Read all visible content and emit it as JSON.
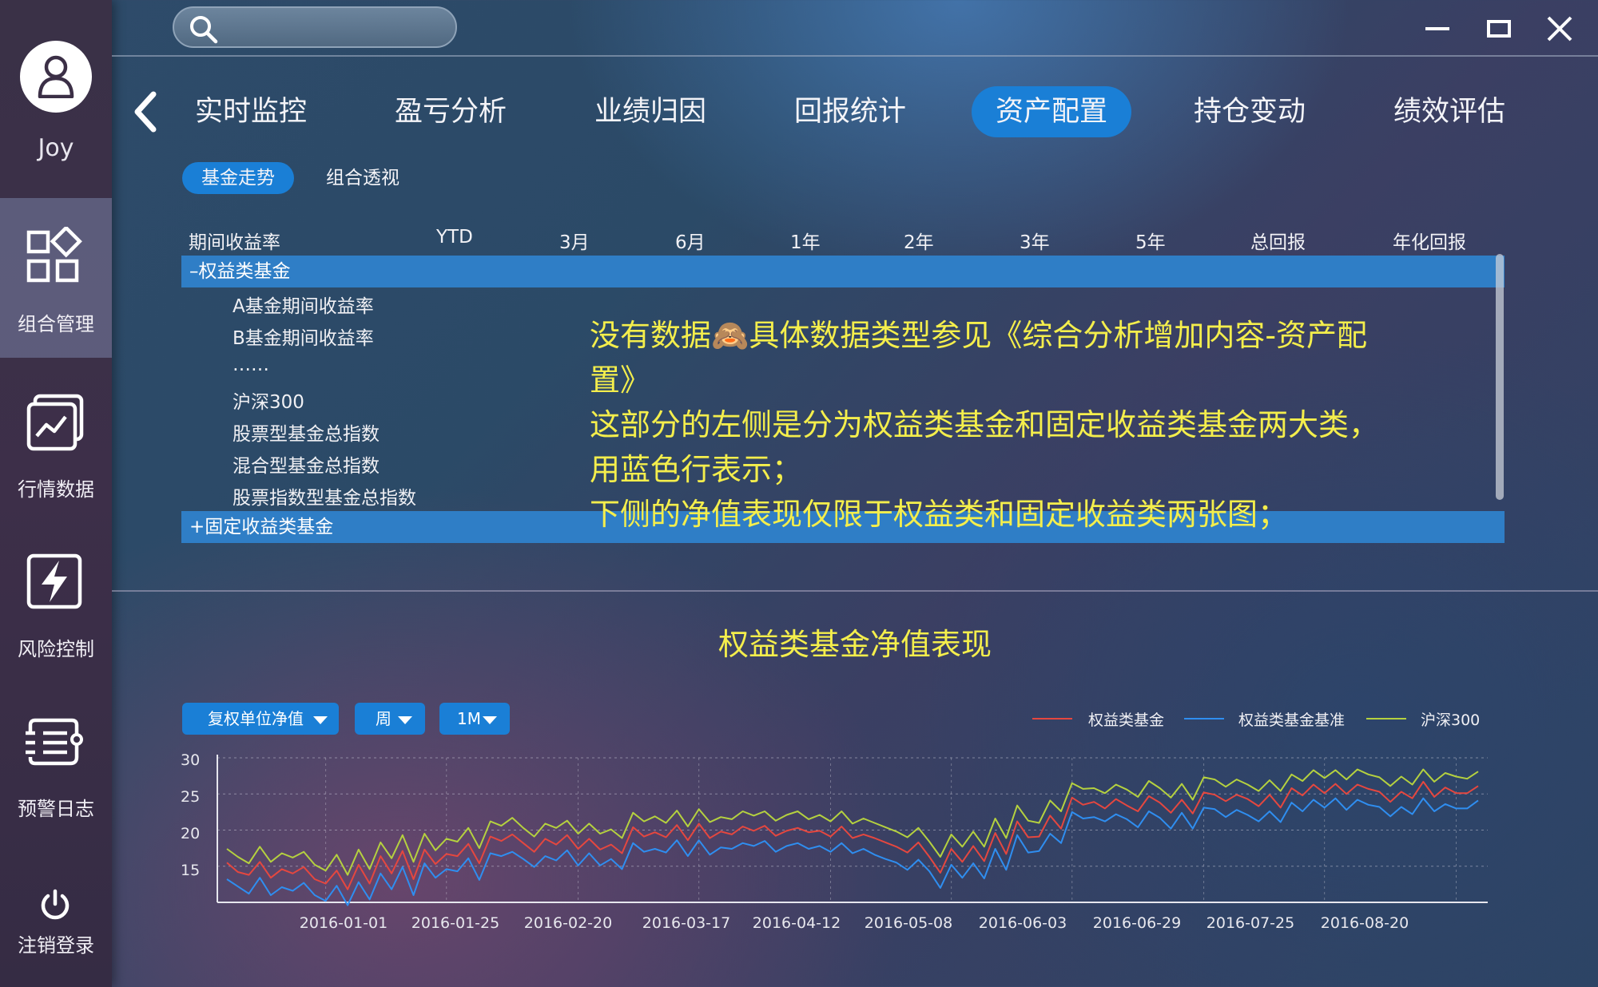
{
  "user": {
    "name": "Joy"
  },
  "sidebar": {
    "items": [
      {
        "label": "组合管理",
        "icon": "grid-icon",
        "active": true
      },
      {
        "label": "行情数据",
        "icon": "market-chart-icon",
        "active": false
      },
      {
        "label": "风险控制",
        "icon": "lightning-icon",
        "active": false
      },
      {
        "label": "预警日志",
        "icon": "log-list-icon",
        "active": false
      }
    ],
    "logout_label": "注销登录",
    "logout_icon": "power-icon"
  },
  "search": {
    "placeholder": "",
    "value": ""
  },
  "window_controls": [
    "minimize-icon",
    "maximize-icon",
    "close-icon"
  ],
  "main_tabs": [
    {
      "label": "实时监控"
    },
    {
      "label": "盈亏分析"
    },
    {
      "label": "业绩归因"
    },
    {
      "label": "回报统计"
    },
    {
      "label": "资产配置",
      "active": true
    },
    {
      "label": "持仓变动"
    },
    {
      "label": "绩效评估"
    }
  ],
  "sub_tabs": [
    {
      "label": "基金走势",
      "active": true
    },
    {
      "label": "组合透视"
    }
  ],
  "table": {
    "columns": [
      "期间收益率",
      "YTD",
      "3月",
      "6月",
      "1年",
      "2年",
      "3年",
      "5年",
      "总回报",
      "年化回报"
    ],
    "groups": [
      {
        "label": "–权益类基金",
        "expanded": true
      },
      {
        "label": "+固定收益类基金",
        "expanded": false
      }
    ],
    "rows": [
      "A基金期间收益率",
      "B基金期间收益率",
      "……",
      "沪深300",
      "股票型基金总指数",
      "混合型基金总指数",
      "股票指数型基金总指数"
    ]
  },
  "annotation": {
    "lines": [
      "没有数据🙈具体数据类型参见《综合分析增加内容-资产配置》",
      "这部分的左侧是分为权益类基金和固定收益类基金两大类，用蓝色行表示；",
      "下侧的净值表现仅限于权益类和固定收益类两张图；"
    ]
  },
  "chart_controls": {
    "value_type": "复权单位净值",
    "frequency": "周",
    "range": "1M"
  },
  "colors": {
    "accent": "#1a7fd6",
    "annotation": "#f4ee4c",
    "series_fund": "#e5473f",
    "series_benchmark": "#2f8ef0",
    "series_hs300": "#b5d13f"
  },
  "chart_data": {
    "type": "line",
    "title": "权益类基金净值表现",
    "x_labels": [
      "2016-01-01",
      "2016-01-25",
      "2016-02-20",
      "2016-03-17",
      "2016-04-12",
      "2016-05-08",
      "2016-06-03",
      "2016-06-29",
      "2016-07-25",
      "2016-08-20"
    ],
    "yticks": [
      15,
      20,
      25,
      30
    ],
    "ylim": [
      10,
      30
    ],
    "grid": true,
    "legend_position": "top-right",
    "series": [
      {
        "name": "权益类基金",
        "color": "#e5473f",
        "values": [
          15.5,
          14.2,
          13.8,
          15.6,
          13.4,
          14.6,
          14.0,
          14.9,
          13.2,
          12.6,
          14.4,
          11.8,
          15.2,
          12.6,
          16.4,
          14.0,
          17.1,
          13.2,
          17.3,
          15.3,
          16.7,
          16.4,
          18.1,
          15.4,
          19.1,
          18.5,
          19.4,
          18.2,
          17.0,
          18.8,
          18.0,
          19.3,
          17.4,
          18.8,
          17.3,
          18.0,
          16.8,
          20.4,
          19.1,
          19.7,
          19.0,
          20.7,
          18.6,
          20.9,
          18.9,
          19.8,
          19.4,
          20.5,
          19.9,
          20.6,
          19.2,
          19.9,
          20.3,
          19.7,
          19.9,
          19.1,
          20.5,
          18.9,
          19.4,
          18.9,
          18.3,
          17.7,
          16.9,
          18.3,
          16.3,
          14.1,
          17.4,
          15.6,
          17.8,
          15.7,
          19.6,
          16.7,
          21.2,
          19.0,
          19.1,
          22.0,
          20.2,
          24.5,
          23.5,
          23.9,
          23.0,
          24.3,
          23.4,
          22.6,
          24.7,
          23.8,
          22.4,
          24.2,
          22.3,
          25.2,
          24.9,
          24.0,
          24.9,
          24.3,
          23.3,
          24.9,
          23.1,
          25.8,
          24.8,
          26.3,
          25.1,
          26.4,
          25.0,
          26.3,
          25.7,
          25.3,
          23.9,
          25.3,
          24.4,
          26.7,
          24.6,
          25.9,
          25.1,
          25.1,
          26.1
        ]
      },
      {
        "name": "权益类基金基准",
        "color": "#2f8ef0",
        "values": [
          13.2,
          12.2,
          11.2,
          13.4,
          11.0,
          12.1,
          11.6,
          12.7,
          11.0,
          10.2,
          12.3,
          9.6,
          12.8,
          10.4,
          14.0,
          11.8,
          14.9,
          11.0,
          15.4,
          13.4,
          14.6,
          14.3,
          16.1,
          13.1,
          16.8,
          16.4,
          17.0,
          16.0,
          14.9,
          16.4,
          15.8,
          17.2,
          15.1,
          16.8,
          15.1,
          16.0,
          14.6,
          18.2,
          17.0,
          17.4,
          16.9,
          18.6,
          16.4,
          18.6,
          16.6,
          17.6,
          17.4,
          18.2,
          17.8,
          18.5,
          17.0,
          17.8,
          18.2,
          17.4,
          17.8,
          17.0,
          18.2,
          16.8,
          17.4,
          16.6,
          16.0,
          15.5,
          14.5,
          15.9,
          14.3,
          12.0,
          15.2,
          13.4,
          15.4,
          13.3,
          17.4,
          14.5,
          19.3,
          16.9,
          17.1,
          19.5,
          18.2,
          22.5,
          21.6,
          21.8,
          21.2,
          22.2,
          21.5,
          20.4,
          22.6,
          21.7,
          20.2,
          22.4,
          20.2,
          23.1,
          22.9,
          21.8,
          22.8,
          22.1,
          21.2,
          22.6,
          21.1,
          23.8,
          22.6,
          24.2,
          23.1,
          24.4,
          22.8,
          24.2,
          23.5,
          23.2,
          21.9,
          23.2,
          22.2,
          24.4,
          22.6,
          23.6,
          23.0,
          23.0,
          24.1
        ]
      },
      {
        "name": "沪深300",
        "color": "#b5d13f",
        "values": [
          17.4,
          16.3,
          15.4,
          17.7,
          15.6,
          16.8,
          16.2,
          17.0,
          15.2,
          14.4,
          16.6,
          13.8,
          17.3,
          14.6,
          18.3,
          16.1,
          19.3,
          15.6,
          19.5,
          17.2,
          18.8,
          18.4,
          20.3,
          17.5,
          21.2,
          20.6,
          21.7,
          20.3,
          19.1,
          20.9,
          20.3,
          21.3,
          19.5,
          20.9,
          19.5,
          20.1,
          18.9,
          22.4,
          21.2,
          21.9,
          21.0,
          22.7,
          20.5,
          22.9,
          21.1,
          21.8,
          21.5,
          22.6,
          22.0,
          22.6,
          21.3,
          22.1,
          22.6,
          21.5,
          22.1,
          21.2,
          22.6,
          20.9,
          21.6,
          21.0,
          20.4,
          19.8,
          19.0,
          20.3,
          18.4,
          16.3,
          19.4,
          17.7,
          19.8,
          17.7,
          21.6,
          18.9,
          23.4,
          21.3,
          21.0,
          24.1,
          22.6,
          26.5,
          25.7,
          25.8,
          25.1,
          26.3,
          25.6,
          24.6,
          26.8,
          25.8,
          24.5,
          26.4,
          24.2,
          27.3,
          27.0,
          26.0,
          27.0,
          26.3,
          25.4,
          26.9,
          25.4,
          27.7,
          26.8,
          28.3,
          27.2,
          28.3,
          27.0,
          28.4,
          27.7,
          27.3,
          26.1,
          27.4,
          26.3,
          28.4,
          26.7,
          27.9,
          27.4,
          27.1,
          28.1
        ]
      }
    ]
  }
}
